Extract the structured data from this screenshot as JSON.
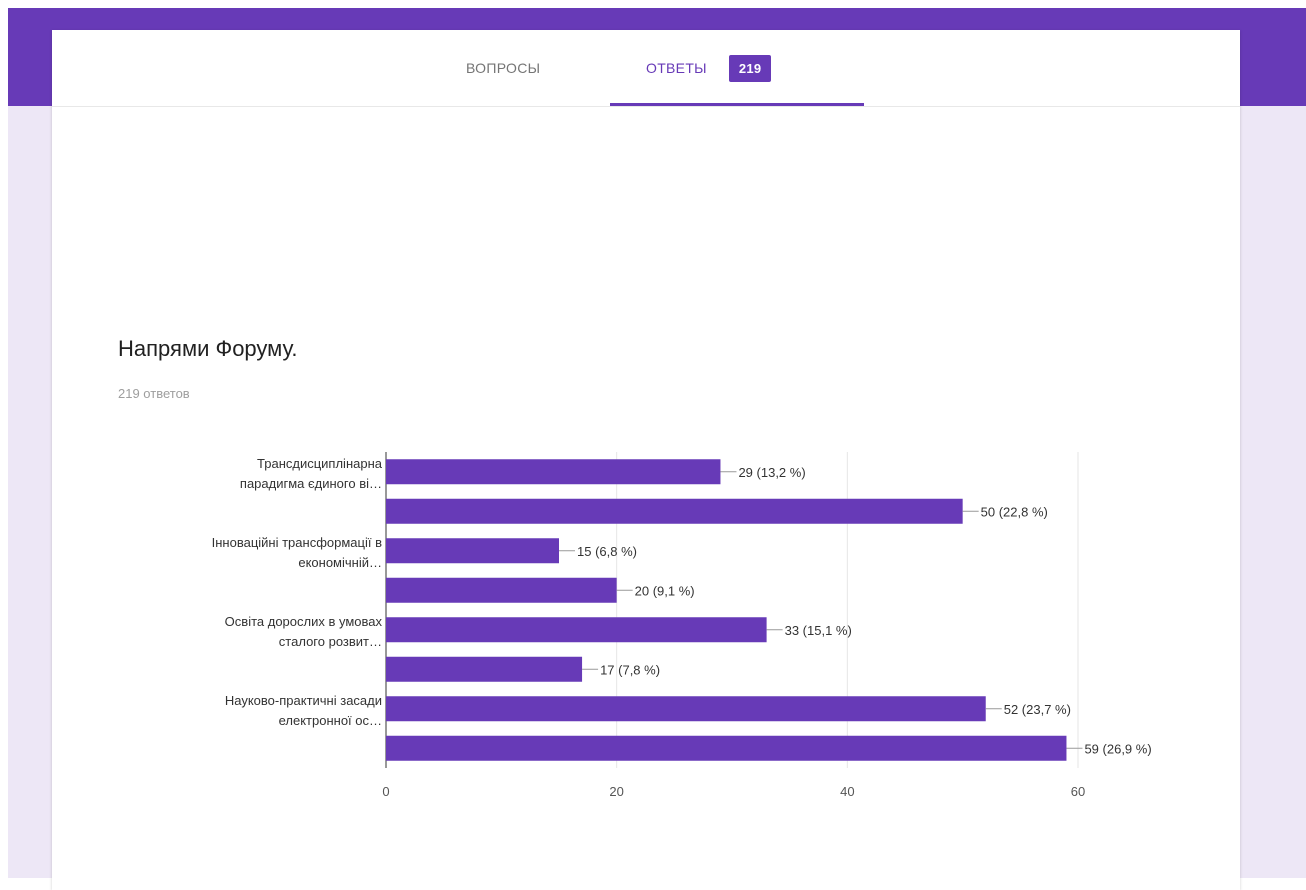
{
  "tabs": {
    "questions_label": "ВОПРОСЫ",
    "answers_label": "ОТВЕТЫ",
    "answers_count": "219"
  },
  "question": {
    "title": "Напрями Форуму.",
    "response_count": "219 ответов"
  },
  "colors": {
    "brand": "#673ab7",
    "background": "#ede7f6"
  },
  "chart_data": {
    "type": "bar",
    "orientation": "horizontal",
    "categories": [
      "Трансдисциплінарна парадигма єдиного ві…",
      "",
      "Інноваційні трансформації в економічній…",
      "",
      "Освіта дорослих в умовах сталого розвит…",
      "",
      "Науково-практичні засади електронної ос…",
      ""
    ],
    "category_lines": [
      [
        "Трансдисциплінарна",
        "парадигма єдиного ві…"
      ],
      [],
      [
        "Інноваційні трансформації в",
        "економічній…"
      ],
      [],
      [
        "Освіта дорослих в умовах",
        "сталого розвит…"
      ],
      [],
      [
        "Науково-практичні засади",
        "електронної ос…"
      ],
      []
    ],
    "values": [
      29,
      50,
      15,
      20,
      33,
      17,
      52,
      59
    ],
    "data_labels": [
      "29 (13,2 %)",
      "50 (22,8 %)",
      "15 (6,8 %)",
      "20 (9,1 %)",
      "33 (15,1 %)",
      "17 (7,8 %)",
      "52 (23,7 %)",
      "59 (26,9 %)"
    ],
    "xlim": [
      0,
      60
    ],
    "xticks": [
      0,
      20,
      40,
      60
    ],
    "grid": true,
    "bar_color": "#673ab7"
  }
}
